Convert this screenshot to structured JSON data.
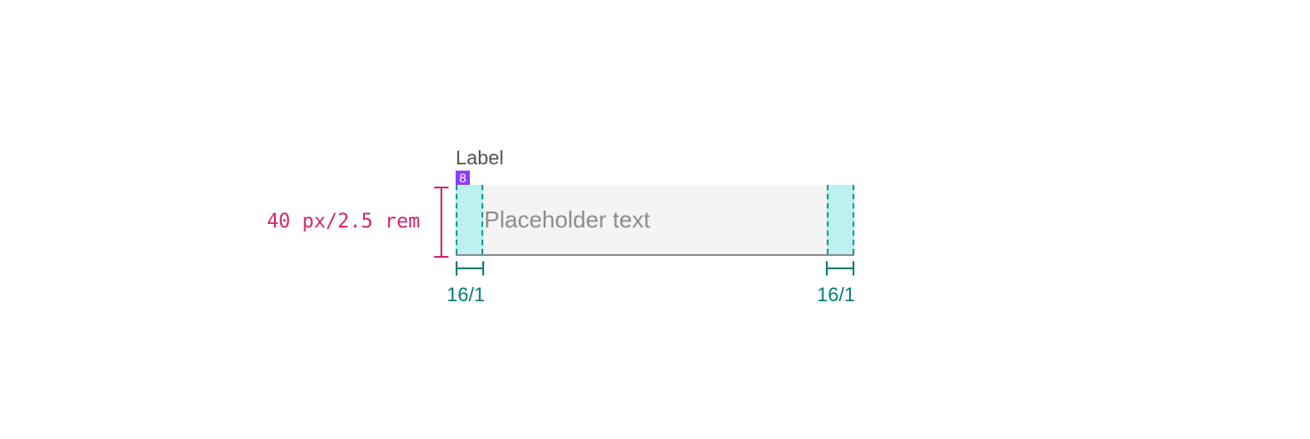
{
  "label": "Label",
  "spacing_badge": "8",
  "placeholder": "Placeholder text",
  "height_measure": "40 px/2.5 rem",
  "padding_left_measure": "16/1",
  "padding_right_measure": "16/1",
  "colors": {
    "field_background": "#f4f4f4",
    "field_border": "#8d8d8d",
    "padding_zone": "#bdf0f0",
    "padding_stroke": "#009d9a",
    "measure_teal": "#007d79",
    "measure_magenta": "#d12771",
    "spacing_purple": "#8a3ffc",
    "label_text": "#525252"
  }
}
